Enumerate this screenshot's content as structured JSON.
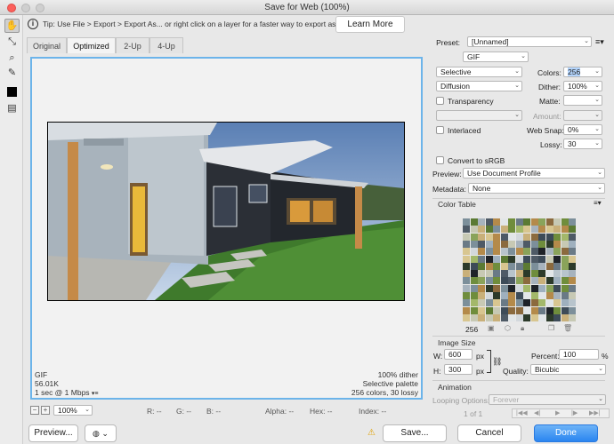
{
  "window": {
    "title": "Save for Web (100%)"
  },
  "tip": {
    "text": "Tip: Use File > Export > Export As...  or right click on a layer for a faster way to export assets",
    "learn_more": "Learn More"
  },
  "tabs": [
    "Original",
    "Optimized",
    "2-Up",
    "4-Up"
  ],
  "preview_info": {
    "format": "GIF",
    "size": "56.01K",
    "speed": "1 sec @ 1 Mbps",
    "dither": "100% dither",
    "palette": "Selective palette",
    "colors": "256 colors, 30 lossy"
  },
  "status": {
    "zoom": "100%",
    "r": "R: --",
    "g": "G: --",
    "b": "B: --",
    "alpha": "Alpha: --",
    "hex": "Hex: --",
    "index": "Index: --"
  },
  "buttons": {
    "preview": "Preview...",
    "save": "Save...",
    "cancel": "Cancel",
    "done": "Done"
  },
  "settings": {
    "preset_label": "Preset:",
    "preset_value": "[Unnamed]",
    "format": "GIF",
    "reduction": "Selective",
    "colors_label": "Colors:",
    "colors_value": "256",
    "dither_algo": "Diffusion",
    "dither_label": "Dither:",
    "dither_value": "100%",
    "transparency_label": "Transparency",
    "matte_label": "Matte:",
    "amount_label": "Amount:",
    "interlaced_label": "Interlaced",
    "websnap_label": "Web Snap:",
    "websnap_value": "0%",
    "lossy_label": "Lossy:",
    "lossy_value": "30",
    "convert_srgb_label": "Convert to sRGB",
    "preview_label": "Preview:",
    "preview_value": "Use Document Profile",
    "metadata_label": "Metadata:",
    "metadata_value": "None"
  },
  "color_table": {
    "title": "Color Table",
    "count": "256"
  },
  "image_size": {
    "title": "Image Size",
    "w_label": "W:",
    "w_value": "600",
    "h_label": "H:",
    "h_value": "300",
    "unit": "px",
    "percent_label": "Percent:",
    "percent_value": "100",
    "percent_unit": "%",
    "quality_label": "Quality:",
    "quality_value": "Bicubic"
  },
  "animation": {
    "title": "Animation",
    "looping_label": "Looping Options:",
    "looping_value": "Forever",
    "frame": "1 of 1"
  },
  "colors": {
    "accent": "#2a85f0",
    "selection": "#6cb4ea"
  }
}
